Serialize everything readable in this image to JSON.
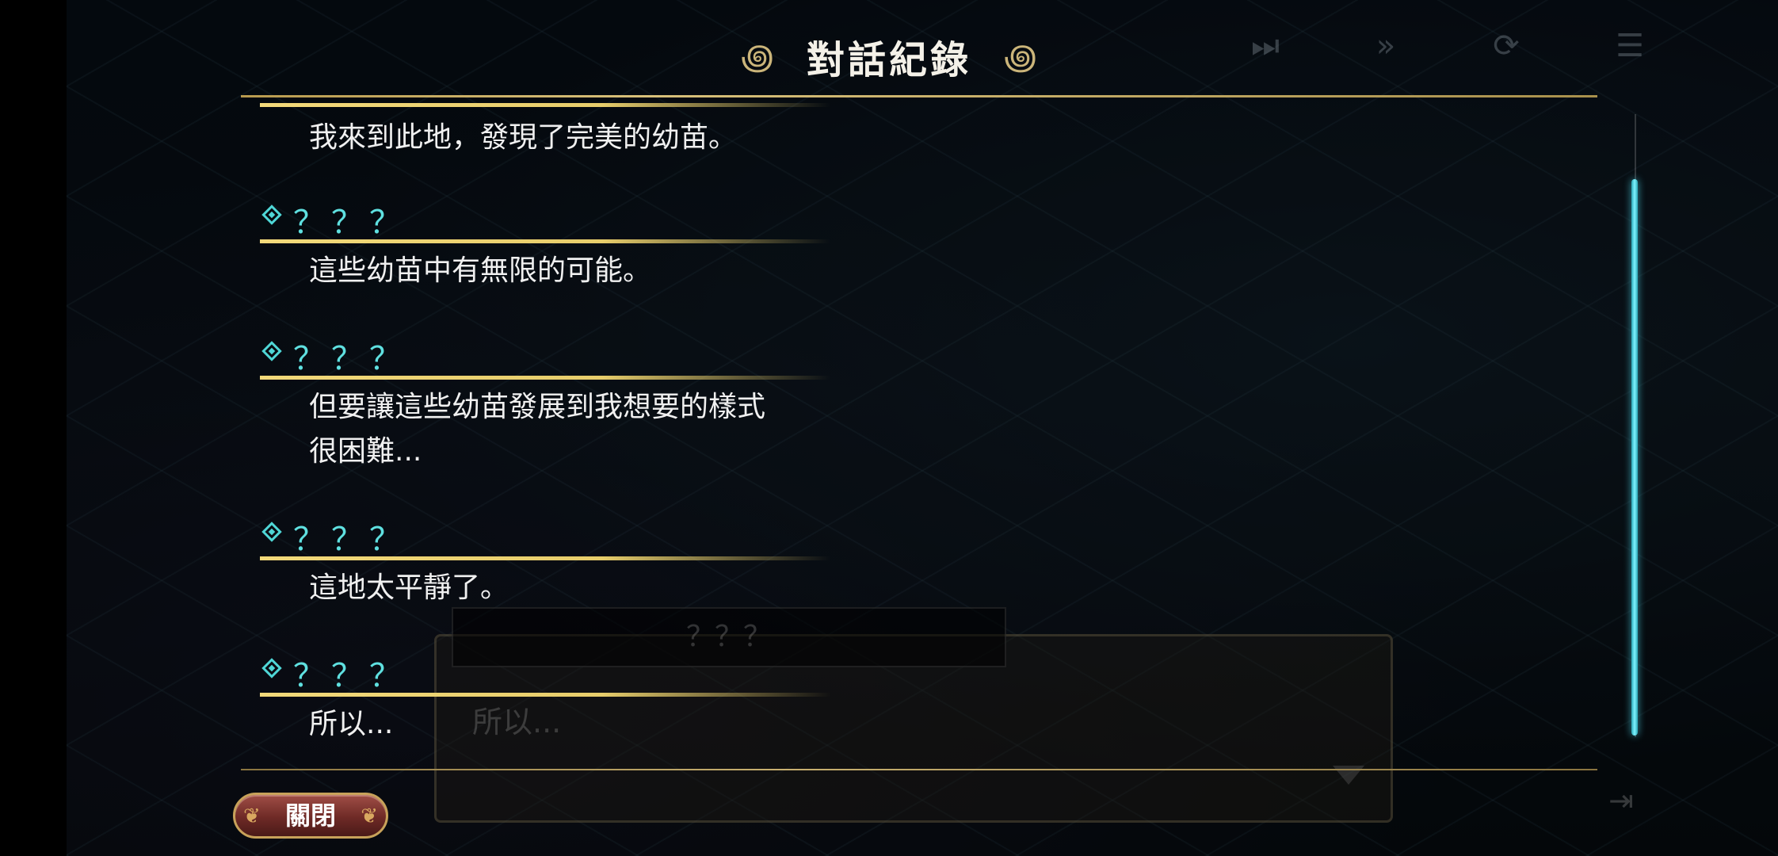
{
  "log": {
    "title": "對話紀錄",
    "entries": [
      {
        "speaker": "",
        "text": "我來到此地，發現了完美的幼苗。"
      },
      {
        "speaker": "？？？",
        "text": "這些幼苗中有無限的可能。"
      },
      {
        "speaker": "？？？",
        "text": "但要讓這些幼苗發展到我想要的樣式\n很困難..."
      },
      {
        "speaker": "？？？",
        "text": "這地太平靜了。"
      },
      {
        "speaker": "？？？",
        "text": "所以..."
      }
    ],
    "close_label": "關閉"
  },
  "game_dialog": {
    "speaker": "？？？",
    "text": "所以..."
  },
  "hud": {
    "icons": [
      "skip-icon",
      "fast-forward-icon",
      "auto-icon",
      "log-icon"
    ]
  },
  "colors": {
    "accent_cyan": "#5fe0e0",
    "gold": "#e7cd6b",
    "button_red": "#6e2a26"
  }
}
